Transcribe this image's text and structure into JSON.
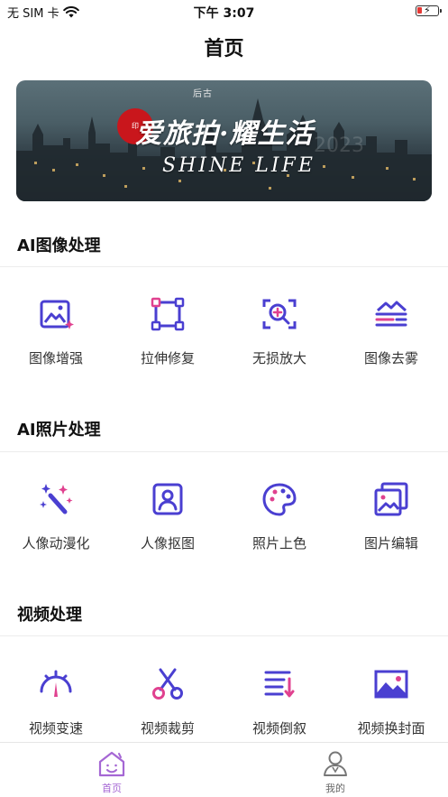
{
  "status_bar": {
    "carrier": "无 SIM 卡",
    "time": "下午 3:07",
    "icons": [
      "wifi-icon",
      "battery-charging-icon"
    ]
  },
  "nav": {
    "title": "首页"
  },
  "banner": {
    "brand": "后古",
    "main_text": "爱旅拍·耀生活",
    "sub_text": "SHINE LIFE",
    "year_watermark": "2023"
  },
  "sections": [
    {
      "title": "AI图像处理",
      "items": [
        {
          "label": "图像增强",
          "icon": "image-enhance-icon"
        },
        {
          "label": "拉伸修复",
          "icon": "stretch-repair-icon"
        },
        {
          "label": "无损放大",
          "icon": "zoom-in-icon"
        },
        {
          "label": "图像去雾",
          "icon": "dehaze-icon"
        }
      ]
    },
    {
      "title": "AI照片处理",
      "items": [
        {
          "label": "人像动漫化",
          "icon": "magic-wand-icon"
        },
        {
          "label": "人像抠图",
          "icon": "portrait-icon"
        },
        {
          "label": "照片上色",
          "icon": "palette-icon"
        },
        {
          "label": "图片编辑",
          "icon": "image-edit-icon"
        }
      ]
    },
    {
      "title": "视频处理",
      "items": [
        {
          "label": "视频变速",
          "icon": "speedometer-icon"
        },
        {
          "label": "视频裁剪",
          "icon": "scissors-icon"
        },
        {
          "label": "视频倒叙",
          "icon": "reverse-list-icon"
        },
        {
          "label": "视频换封面",
          "icon": "cover-image-icon"
        }
      ]
    }
  ],
  "tab_bar": {
    "tabs": [
      {
        "label": "首页",
        "icon": "home-icon",
        "active": true
      },
      {
        "label": "我的",
        "icon": "user-icon",
        "active": false
      }
    ]
  },
  "colors": {
    "icon_primary": "#4A3FD1",
    "icon_accent": "#E0418F",
    "tab_active": "#A567D4",
    "tab_inactive": "#666666"
  }
}
